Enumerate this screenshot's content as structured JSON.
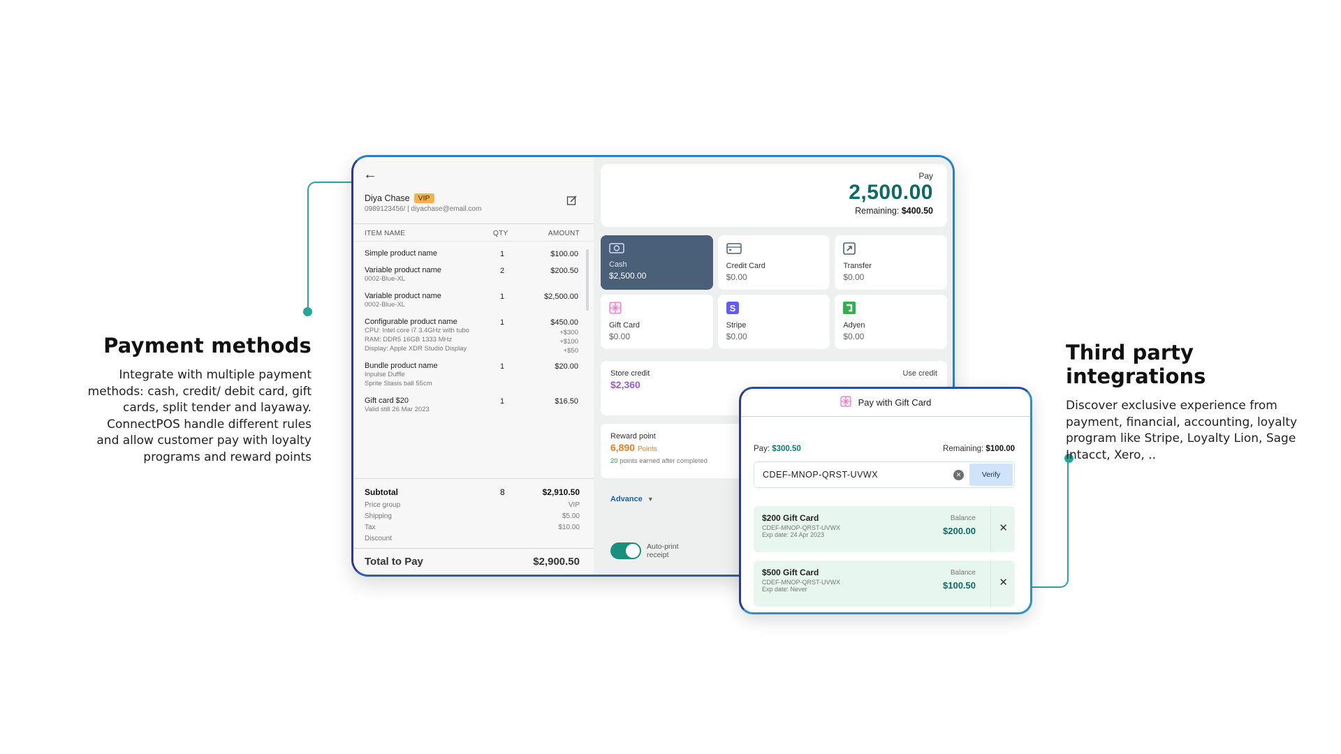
{
  "captions": {
    "left": {
      "title": "Payment methods",
      "body": "Integrate with multiple payment methods: cash, credit/ debit card, gift cards, split tender and layaway. ConnectPOS handle different rules and allow customer pay with loyalty programs and reward points"
    },
    "right": {
      "title": "Third party integrations",
      "body": "Discover exclusive experience from payment, financial, accounting, loyalty program like Stripe, Loyalty Lion, Sage Intacct, Xero, .."
    }
  },
  "customer": {
    "name": "Diya Chase",
    "badge": "VIP",
    "contact": "0989123456/ | diyachase@email.com"
  },
  "cart": {
    "headers": {
      "item": "ITEM NAME",
      "qty": "QTY",
      "amount": "AMOUNT"
    },
    "items": [
      {
        "name": "Simple product name",
        "qty": "1",
        "amount": "$100.00",
        "sub": [],
        "subamts": []
      },
      {
        "name": "Variable product name",
        "qty": "2",
        "amount": "$200.50",
        "sub": [
          "0002-Blue-XL"
        ],
        "subamts": []
      },
      {
        "name": "Variable product name",
        "qty": "1",
        "amount": "$2,500.00",
        "sub": [
          "0002-Blue-XL"
        ],
        "subamts": []
      },
      {
        "name": "Configurable product name",
        "qty": "1",
        "amount": "$450.00",
        "sub": [
          "CPU: Intel core i7 3.4GHz with tubo",
          "RAM: DDR5 16GB 1333 MHz",
          "Display: Apple XDR Studio Display"
        ],
        "subamts": [
          "+$300",
          "+$100",
          "+$50"
        ]
      },
      {
        "name": "Bundle product name",
        "qty": "1",
        "amount": "$20.00",
        "sub": [
          "Inpulse Duffle",
          "Sprite Stasis ball 55cm"
        ],
        "subamts": []
      },
      {
        "name": "Gift card $20",
        "qty": "1",
        "amount": "$16.50",
        "sub": [
          "Valid still 26 Mar 2023"
        ],
        "subamts": []
      }
    ],
    "summary": {
      "subtotal_label": "Subtotal",
      "subtotal_qty": "8",
      "subtotal": "$2,910.50",
      "price_group_label": "Price group",
      "price_group": "VIP",
      "shipping_label": "Shipping",
      "shipping": "$5.00",
      "tax_label": "Tax",
      "tax": "$10.00",
      "discount_label": "Discount",
      "discount": ""
    },
    "total_label": "Total to Pay",
    "total": "$2,900.50"
  },
  "payment": {
    "pay_label": "Pay",
    "pay_amount": "2,500.00",
    "remaining_label": "Remaining:",
    "remaining": "$400.50",
    "methods": [
      {
        "name": "Cash",
        "value": "$2,500.00",
        "icon": "cash-icon",
        "active": true
      },
      {
        "name": "Credit Card",
        "value": "$0.00",
        "icon": "credit-card-icon",
        "active": false
      },
      {
        "name": "Transfer",
        "value": "$0.00",
        "icon": "transfer-icon",
        "active": false
      },
      {
        "name": "Gift Card",
        "value": "$0.00",
        "icon": "gift-card-icon",
        "active": false
      },
      {
        "name": "Stripe",
        "value": "$0.00",
        "icon": "stripe-icon",
        "active": false
      },
      {
        "name": "Adyen",
        "value": "$0.00",
        "icon": "adyen-icon",
        "active": false
      }
    ],
    "store_credit_label": "Store credit",
    "store_credit": "$2,360",
    "use_credit": "Use credit",
    "reward_label": "Reward point",
    "reward_points": "6,890",
    "reward_unit": "Points",
    "earn_points": "20",
    "earn_text": " points earned after completed",
    "advance": "Advance",
    "auto_print": "Auto-print receipt",
    "auto_print_on": true
  },
  "dialog": {
    "title": "Pay with Gift Card",
    "pay_label": "Pay:",
    "pay": "$300.50",
    "remaining_label": "Remaining:",
    "remaining": "$100.00",
    "code_value": "CDEF-MNOP-QRST-UVWX",
    "verify": "Verify",
    "cards": [
      {
        "name": "$200 Gift Card",
        "code": "CDEF-MNOP-QRST-UVWX",
        "exp": "Exp date: 24 Apr 2023",
        "balance_label": "Balance",
        "balance": "$200.00"
      },
      {
        "name": "$500 Gift Card",
        "code": "CDEF-MNOP-QRST-UVWX",
        "exp": "Exp date: Never",
        "balance_label": "Balance",
        "balance": "$100.50"
      }
    ]
  },
  "colors": {
    "accent_teal": "#0d6b63",
    "connector": "#26a69a",
    "cash_active": "#4a6078",
    "store_credit": "#9b59d0",
    "reward": "#e67e22",
    "vip": "#f6b24a"
  }
}
